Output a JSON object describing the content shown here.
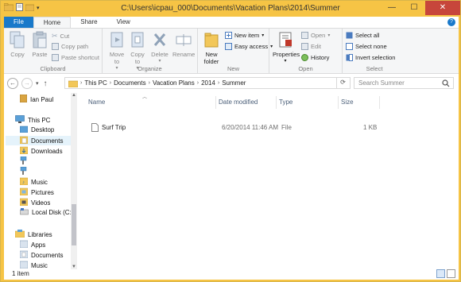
{
  "window": {
    "title": "C:\\Users\\icpau_000\\Documents\\Vacation Plans\\2014\\Summer",
    "minimize": "—",
    "maximize": "☐",
    "close": "✕"
  },
  "tabs": {
    "file": "File",
    "home": "Home",
    "share": "Share",
    "view": "View",
    "help": "?"
  },
  "ribbon": {
    "clipboard": {
      "label": "Clipboard",
      "copy": "Copy",
      "paste": "Paste",
      "cut": "Cut",
      "copy_path": "Copy path",
      "paste_shortcut": "Paste shortcut"
    },
    "organize": {
      "label": "Organize",
      "move_to": "Move to",
      "copy_to": "Copy to",
      "delete": "Delete",
      "rename": "Rename"
    },
    "new": {
      "label": "New",
      "new_folder": "New folder",
      "new_item": "New item",
      "easy_access": "Easy access"
    },
    "open": {
      "label": "Open",
      "properties": "Properties",
      "open": "Open",
      "edit": "Edit",
      "history": "History"
    },
    "select": {
      "label": "Select",
      "select_all": "Select all",
      "select_none": "Select none",
      "invert_selection": "Invert selection"
    }
  },
  "address": {
    "crumbs": [
      "This PC",
      "Documents",
      "Vacation Plans",
      "2014",
      "Summer"
    ],
    "search_placeholder": "Search Summer"
  },
  "navpane": {
    "user": "Ian Paul",
    "this_pc": "This PC",
    "desktop": "Desktop",
    "documents": "Documents",
    "downloads": "Downloads",
    "music": "Music",
    "pictures": "Pictures",
    "videos": "Videos",
    "local_disk": "Local Disk (C:)",
    "libraries": "Libraries",
    "apps": "Apps",
    "lib_documents": "Documents",
    "lib_music": "Music"
  },
  "columns": {
    "name": "Name",
    "date_modified": "Date modified",
    "type": "Type",
    "size": "Size"
  },
  "files": [
    {
      "name": "Surf Trip",
      "date_modified": "6/20/2014 11:46 AM",
      "type": "File",
      "size": "1 KB"
    }
  ],
  "status": {
    "count": "1 item"
  },
  "colors": {
    "titlebar": "#f6c445",
    "file_tab": "#1979ca",
    "close": "#c7463b"
  }
}
